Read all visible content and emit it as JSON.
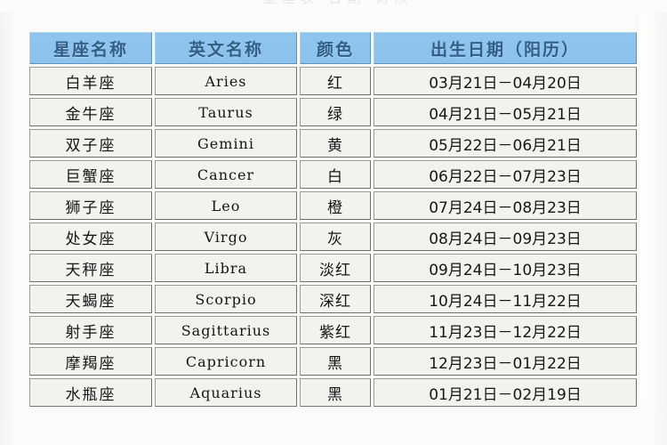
{
  "page": {
    "top_partial_text": "星座表 日期 对照",
    "background_color": "#fbfbfa"
  },
  "table": {
    "name": "zodiac-sign-date-table",
    "header_background": "#8cc2ec",
    "header_text_color": "#2f5d86",
    "cell_background": "#f2f2ee",
    "cell_border_color": "#6f6f6a",
    "columns": [
      {
        "key": "cn_name",
        "label": "星座名称"
      },
      {
        "key": "en_name",
        "label": "英文名称"
      },
      {
        "key": "color",
        "label": "颜色"
      },
      {
        "key": "date",
        "label": "出生日期（阳历）"
      }
    ],
    "rows": [
      {
        "cn_name": "白羊座",
        "en_name": "Aries",
        "color": "红",
        "date": "03月21日－04月20日"
      },
      {
        "cn_name": "金牛座",
        "en_name": "Taurus",
        "color": "绿",
        "date": "04月21日－05月21日"
      },
      {
        "cn_name": "双子座",
        "en_name": "Gemini",
        "color": "黄",
        "date": "05月22日－06月21日"
      },
      {
        "cn_name": "巨蟹座",
        "en_name": "Cancer",
        "color": "白",
        "date": "06月22日－07月23日"
      },
      {
        "cn_name": "狮子座",
        "en_name": "Leo",
        "color": "橙",
        "date": "07月24日－08月23日"
      },
      {
        "cn_name": "处女座",
        "en_name": "Virgo",
        "color": "灰",
        "date": "08月24日－09月23日"
      },
      {
        "cn_name": "天秤座",
        "en_name": "Libra",
        "color": "淡红",
        "date": "09月24日－10月23日"
      },
      {
        "cn_name": "天蝎座",
        "en_name": "Scorpio",
        "color": "深红",
        "date": "10月24日－11月22日"
      },
      {
        "cn_name": "射手座",
        "en_name": "Sagittarius",
        "color": "紫红",
        "date": "11月23日－12月22日"
      },
      {
        "cn_name": "摩羯座",
        "en_name": "Capricorn",
        "color": "黑",
        "date": "12月23日－01月22日"
      },
      {
        "cn_name": "水瓶座",
        "en_name": "Aquarius",
        "color": "黑",
        "date": "01月21日－02月19日"
      }
    ]
  }
}
